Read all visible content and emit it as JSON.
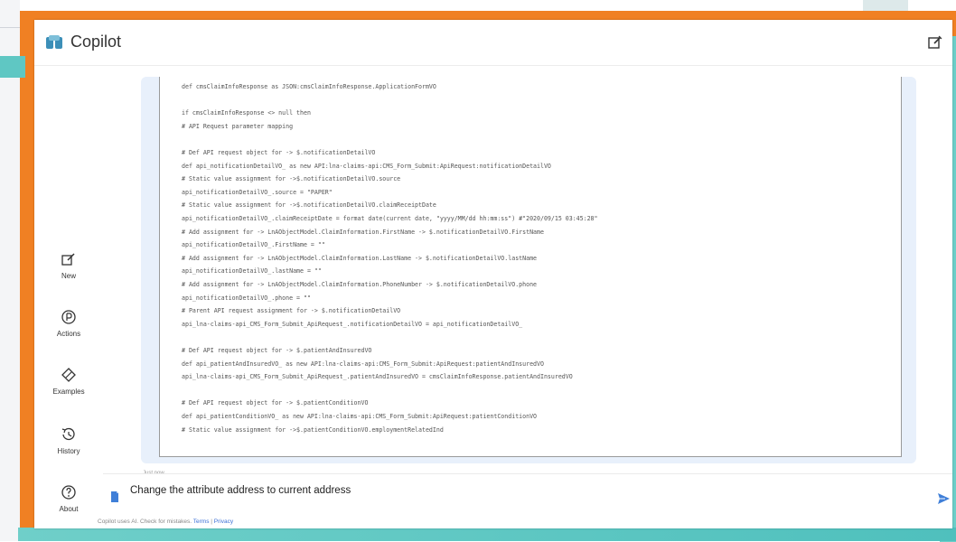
{
  "app": {
    "title": "Copilot"
  },
  "sidebar": {
    "items": [
      {
        "label": "New",
        "icon": "new-chat-icon"
      },
      {
        "label": "Actions",
        "icon": "actions-icon"
      },
      {
        "label": "Examples",
        "icon": "examples-icon"
      },
      {
        "label": "History",
        "icon": "history-icon"
      },
      {
        "label": "About",
        "icon": "about-icon"
      }
    ]
  },
  "message": {
    "code_lines": [
      "def cmsClaimInfoResponse as JSON:cmsClaimInfoResponse.ApplicationFormVO",
      "",
      "if cmsClaimInfoResponse <> null then",
      "# API Request parameter mapping",
      "",
      "# Def API request object for -> $.notificationDetailVO",
      "def api_notificationDetailVO_ as new API:lna-claims-api:CMS_Form_Submit:ApiRequest:notificationDetailVO",
      "# Static value assignment for ->$.notificationDetailVO.source",
      "api_notificationDetailVO_.source = \"PAPER\"",
      "# Static value assignment for ->$.notificationDetailVO.claimReceiptDate",
      "api_notificationDetailVO_.claimReceiptDate = format date(current date, \"yyyy/MM/dd hh:mm:ss\") #\"2020/09/15 03:45:28\"",
      "# Add assignment for -> LnAObjectModel.ClaimInformation.FirstName -> $.notificationDetailVO.FirstName",
      "api_notificationDetailVO_.FirstName = \"\"",
      "# Add assignment for -> LnAObjectModel.ClaimInformation.LastName -> $.notificationDetailVO.lastName",
      "api_notificationDetailVO_.lastName = \"\"",
      "# Add assignment for -> LnAObjectModel.ClaimInformation.PhoneNumber -> $.notificationDetailVO.phone",
      "api_notificationDetailVO_.phone = \"\"",
      "# Parent API request assignment for -> $.notificationDetailVO",
      "api_lna-claims-api_CMS_Form_Submit_ApiRequest_.notificationDetailVO = api_notificationDetailVO_",
      "",
      "# Def API request object for -> $.patientAndInsuredVO",
      "def api_patientAndInsuredVO_ as new API:lna-claims-api:CMS_Form_Submit:ApiRequest:patientAndInsuredVO",
      "api_lna-claims-api_CMS_Form_Submit_ApiRequest_.patientAndInsuredVO = cmsClaimInfoResponse.patientAndInsuredVO",
      "",
      "# Def API request object for -> $.patientConditionVO",
      "def api_patientConditionVO_ as new API:lna-claims-api:CMS_Form_Submit:ApiRequest:patientConditionVO",
      "# Static value assignment for ->$.patientConditionVO.employmentRelatedInd"
    ],
    "timestamp": "Just now"
  },
  "composer": {
    "text": "Change the attribute address to current address"
  },
  "footer": {
    "text": "Copilot uses AI. Check for mistakes.",
    "terms": "Terms",
    "sep": "|",
    "privacy": "Privacy"
  },
  "colors": {
    "accent_orange": "#f08023",
    "accent_teal": "#5fc7c3",
    "message_bg": "#e8f0fb",
    "link": "#3b6fd6"
  }
}
